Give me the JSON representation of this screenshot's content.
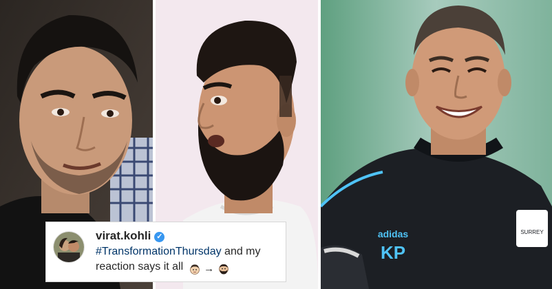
{
  "panels": [
    {
      "description_icon": "young-man-photo"
    },
    {
      "description_icon": "bearded-man-photo"
    },
    {
      "description_icon": "smiling-cricketer-photo"
    }
  ],
  "jersey": {
    "brand": "adidas",
    "initials": "KP",
    "badge": "SURREY"
  },
  "post": {
    "username": "virat.kohli",
    "hashtag": "#TransformationThursday",
    "caption_rest": " and my reaction says it all",
    "arrow": "→"
  },
  "colors": {
    "link": "#003569",
    "verified": "#3897f0",
    "jersey": "#1c1f24",
    "jersey_accent": "#4fc3f7"
  }
}
